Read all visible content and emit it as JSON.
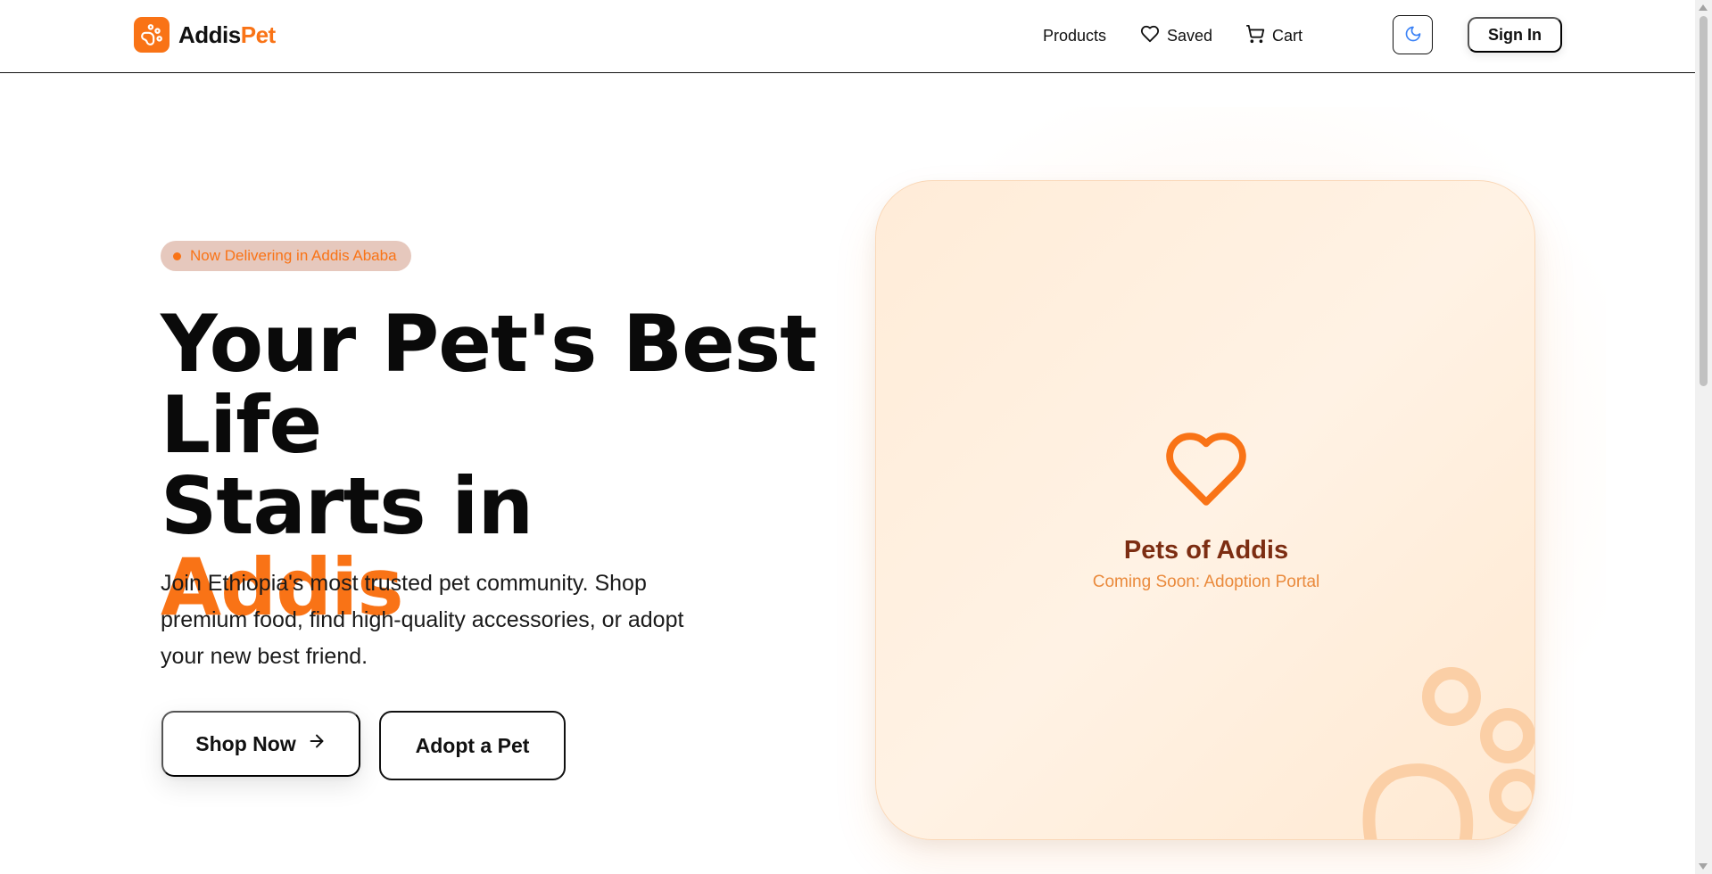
{
  "brand": {
    "name_part1": "Addis",
    "name_part2": "Pet",
    "logo_icon": "paw-icon",
    "accent_color": "#f97316"
  },
  "nav": {
    "products": "Products",
    "saved": "Saved",
    "saved_icon": "heart-icon",
    "cart": "Cart",
    "cart_icon": "cart-icon",
    "theme_toggle_icon": "moon-icon",
    "sign_in": "Sign In"
  },
  "hero": {
    "badge": "Now Delivering in Addis Ababa",
    "headline_line1": "Your Pet's Best",
    "headline_line2": "Life",
    "headline_line3_prefix": "Starts in ",
    "headline_line3_accent": "Addis",
    "subcopy": "Join Ethiopia's most trusted pet community. Shop premium food, find high-quality accessories, or adopt your new best friend.",
    "cta_primary": "Shop Now",
    "cta_primary_icon": "arrow-right-icon",
    "cta_secondary": "Adopt a Pet"
  },
  "card": {
    "icon": "heart-icon",
    "title": "Pets of Addis",
    "subtitle": "Coming Soon: Adoption Portal",
    "decoration_icon": "paw-icon"
  },
  "colors": {
    "accent": "#f97316",
    "card_title": "#7c2d12",
    "card_subtitle": "#ea8a3c",
    "badge_bg": "#e6c8bd"
  }
}
